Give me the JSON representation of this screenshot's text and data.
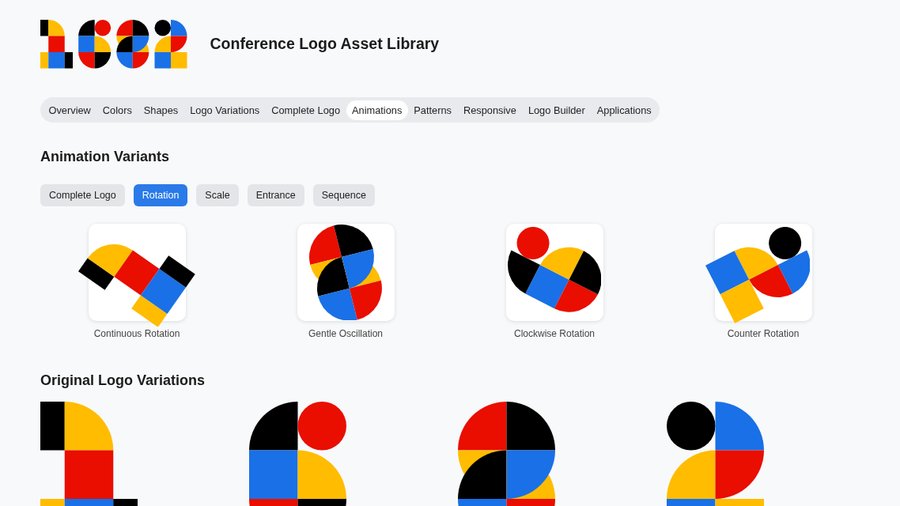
{
  "header": {
    "title": "Conference Logo Asset Library"
  },
  "nav_tabs": [
    {
      "label": "Overview",
      "selected": false
    },
    {
      "label": "Colors",
      "selected": false
    },
    {
      "label": "Shapes",
      "selected": false
    },
    {
      "label": "Logo Variations",
      "selected": false
    },
    {
      "label": "Complete Logo",
      "selected": false
    },
    {
      "label": "Animations",
      "selected": true
    },
    {
      "label": "Patterns",
      "selected": false
    },
    {
      "label": "Responsive",
      "selected": false
    },
    {
      "label": "Logo Builder",
      "selected": false
    },
    {
      "label": "Applications",
      "selected": false
    }
  ],
  "animation_variants": {
    "heading": "Animation Variants",
    "filters": [
      {
        "label": "Complete Logo",
        "selected": false
      },
      {
        "label": "Rotation",
        "selected": true
      },
      {
        "label": "Scale",
        "selected": false
      },
      {
        "label": "Entrance",
        "selected": false
      },
      {
        "label": "Sequence",
        "selected": false
      }
    ],
    "items": [
      {
        "kind": "one",
        "label": "Continuous Rotation"
      },
      {
        "kind": "eight",
        "label": "Gentle Oscillation"
      },
      {
        "kind": "six",
        "label": "Clockwise Rotation"
      },
      {
        "kind": "two",
        "label": "Counter Rotation"
      }
    ]
  },
  "original_variations": {
    "heading": "Original Logo Variations",
    "items": [
      {
        "kind": "one"
      },
      {
        "kind": "six"
      },
      {
        "kind": "eight"
      },
      {
        "kind": "two"
      }
    ]
  }
}
